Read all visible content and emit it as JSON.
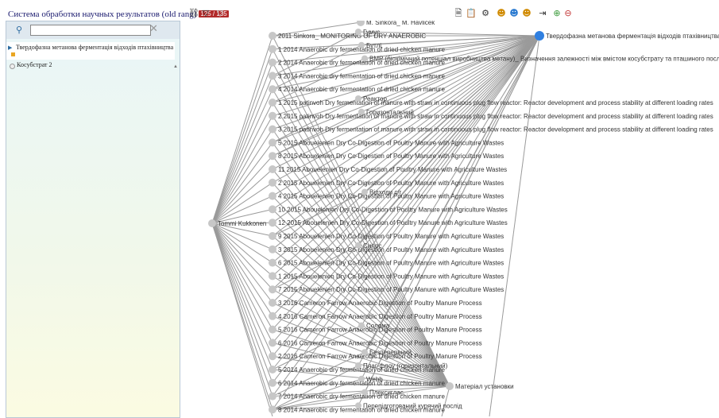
{
  "app": {
    "title": "Система обработки научных результатов (old rang)",
    "badge": "125 / 135"
  },
  "toolbar": {
    "left_icons": [
      "tree-icon",
      "filter-icon",
      "filter-disabled-icon"
    ],
    "center_icons": [
      "document-icon",
      "clipboard-icon",
      "gear-icon",
      "people-icon",
      "people-icon",
      "people-icon",
      "export-icon",
      "zoom-in-icon",
      "zoom-out-icon"
    ]
  },
  "sidebar": {
    "search": {
      "value": "",
      "placeholder": ""
    },
    "tree": [
      {
        "label": "Твердофазна метанова ферментація відходів птахівництва",
        "selected": true
      },
      {
        "label": "Косубстрат 2",
        "selected": false
      }
    ]
  },
  "graph": {
    "root": {
      "label": "Твердофазна метанова ферментація відходів птахівництва",
      "color": "#2f7fe0"
    },
    "author": "Tommi Kukkonen",
    "top_node": "M. Sinkora_ M. Havlicek",
    "node_color": "#c7c7c7",
    "edge_color": "#9a9a9a",
    "papers": [
      "2011 Sinkora_ MONITORING OF DRY ANAEROBIC",
      "1 2014 Anaerobic dry fermentation of dried chicken manure",
      "2 2014 Anaerobic dry fermentation of dried chicken manure",
      "3 2014 Anaerobic dry fermentation of dried chicken manure",
      "4 2014 Anaerobic dry fermentation of dried chicken manure",
      "1 2015 patinvoh Dry fermentation of manure with straw in continuous plug flow reactor: Reactor development and process stability at different loading rates",
      "2 2015 patinvoh Dry fermentation of manure with straw in continuous plug flow reactor: Reactor development and process stability at different loading rates",
      "3 2015 patinvoh Dry fermentation of manure with straw in continuous plug flow reactor: Reactor development and process stability at different loading rates",
      "5 2015 Abouelenien Dry Co-Digestion of Poultry Manure with Agriculture Wastes",
      "8 2015 Abouelenien Dry Co-Digestion of Poultry Manure with Agriculture Wastes",
      "11 2015 Abouelenien Dry Co-Digestion of Poultry Manure with Agriculture Wastes",
      "2 2015 Abouelenien Dry Co-Digestion of Poultry Manure with Agriculture Wastes",
      "4 2015 Abouelenien Dry Co-Digestion of Poultry Manure with Agriculture Wastes",
      "10 2015 Abouelenien Dry Co-Digestion of Poultry Manure with Agriculture Wastes",
      "12 2015 Abouelenien Dry Co-Digestion of Poultry Manure with Agriculture Wastes",
      "9 2015 Abouelenien Dry Co-Digestion of Poultry Manure with Agriculture Wastes",
      "3 2015 Abouelenien Dry Co-Digestion of Poultry Manure with Agriculture Wastes",
      "6 2015 Abouelenien Dry Co-Digestion of Poultry Manure with Agriculture Wastes",
      "1 2015 Abouelenien Dry Co-Digestion of Poultry Manure with Agriculture Wastes",
      "7 2015 Abouelenien Dry Co-Digestion of Poultry Manure with Agriculture Wastes",
      "3 2016 Cameron Farrow Anaerobic Digestion of Poultry Manure Process",
      "4 2016 Cameron Farrow Anaerobic Digestion of Poultry Manure Process",
      "5 2016 Cameron Farrow Anaerobic Digestion of Poultry Manure Process",
      "6 2016 Cameron Farrow Anaerobic Digestion of Poultry Manure Process",
      "2 2016 Cameron Farrow Anaerobic Digestion of Poultry Manure Process",
      "5 2014 Anaerobic dry fermentation of dried chicken manure",
      "6 2014 Anaerobic dry fermentation of dried chicken manure",
      "7 2014 Anaerobic dry fermentation of dried chicken manure",
      "8 2014 Anaerobic dry fermentation of dried chicken manure"
    ],
    "concepts": [
      {
        "label": "Гумус",
        "row": 0
      },
      {
        "label": "Бутлі",
        "row": 1
      },
      {
        "label": "BMP (біохімічний потенціал виробництва метану)_ Визначення залежності між вмістом косубстрату та пташиного посліду",
        "row": 2
      },
      {
        "label": "Реактор",
        "row": 5
      },
      {
        "label": "Горизонтальний",
        "row": 6
      },
      {
        "label": "Відходи с/г",
        "row": 12
      },
      {
        "label": "Силос",
        "row": 16
      },
      {
        "label": "Солома",
        "row": 22
      },
      {
        "label": "Безперервний",
        "row": 24
      },
      {
        "label": "Плаг-флоу (горизонтальний)",
        "row": 25
      },
      {
        "label": "Webb",
        "row": 26
      },
      {
        "label": "Плексиглас",
        "row": 27
      },
      {
        "label": "Перепідготований курячий послід",
        "row": 28
      }
    ],
    "material": "Матеріал установки"
  }
}
